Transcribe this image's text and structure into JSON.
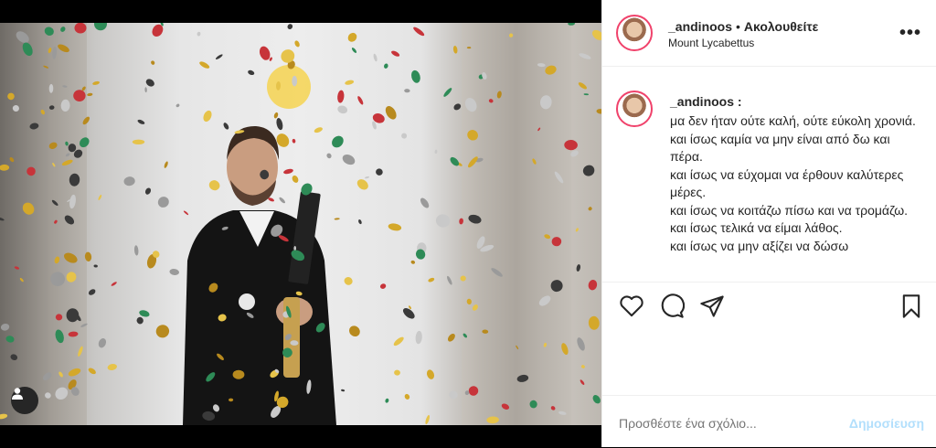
{
  "post": {
    "username": "_andinoos",
    "follow_status": "Ακολουθείτε",
    "location": "Mount Lycabettus",
    "more_label": "•••",
    "caption_user": "_andinoos :",
    "caption_text": "μα δεν ήταν ούτε καλή, ούτε εύκολη χρονιά.\nκαι ίσως καμία να μην είναι από δω και πέρα.\nκαι ίσως να εύχομαι να έρθουν καλύτερες μέρες.\nκαι ίσως να κοιτάζω πίσω και να τρομάζω.\nκαι ίσως τελικά να είμαι λάθος.\nκαι ίσως να μην αξίζει να δώσω"
  },
  "icons": {
    "like": "heart-icon",
    "comment": "comment-icon",
    "share": "share-icon",
    "save": "bookmark-icon",
    "tagged_user": "user-icon"
  },
  "comment": {
    "placeholder": "Προσθέστε ένα σχόλιο...",
    "post_label": "Δημοσίευση"
  },
  "colors": {
    "accent_disabled": "#b2dffc",
    "story_ring": "#f0426b",
    "text": "#262626"
  }
}
